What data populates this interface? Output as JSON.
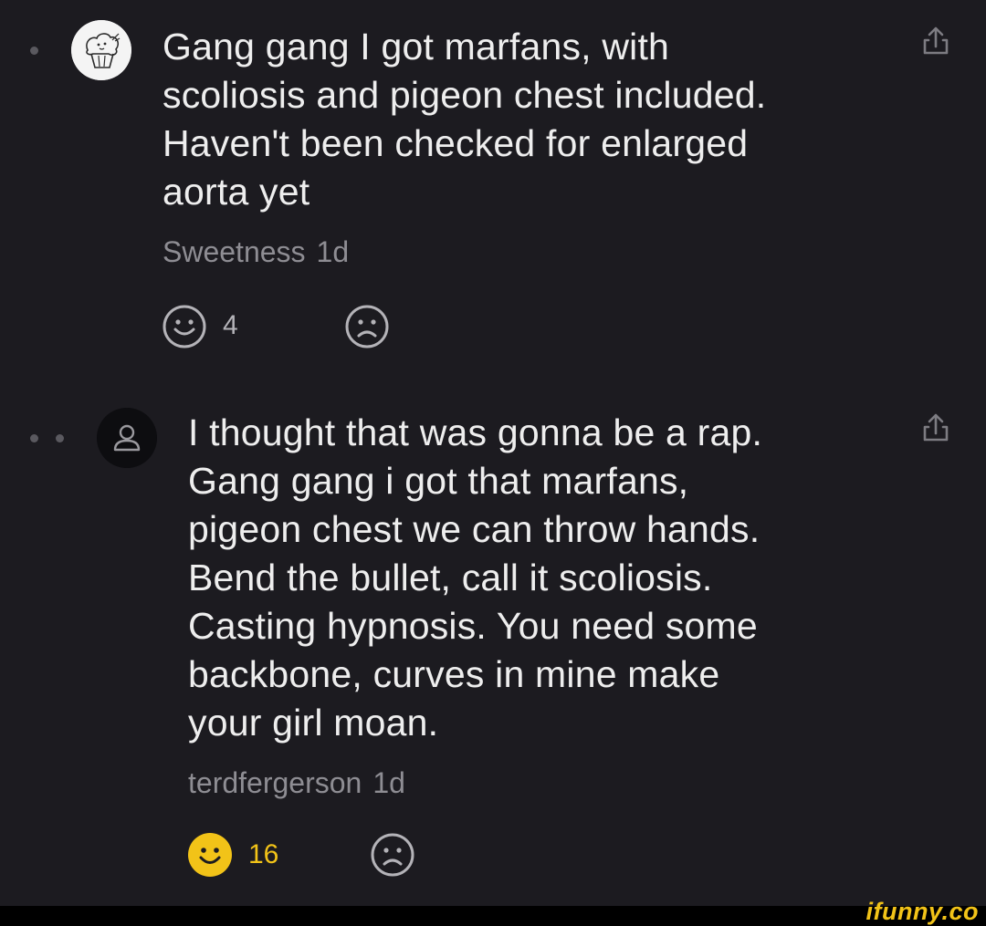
{
  "comments": [
    {
      "text": "Gang gang I got marfans, with\nscoliosis and pigeon chest included.\nHaven't been checked for enlarged\naorta yet",
      "author": "Sweetness",
      "time": "1d",
      "like_count": "4",
      "liked": false,
      "avatar_icon": "muffin-drawing-icon",
      "depth": 1
    },
    {
      "text": "I thought that was gonna be a rap.\nGang gang i got that marfans,\npigeon chest we can throw hands.\nBend the bullet, call it scoliosis.\nCasting hypnosis. You need some\nbackbone, curves in mine make\nyour girl moan.",
      "author": "terdfergerson",
      "time": "1d",
      "like_count": "16",
      "liked": true,
      "avatar_icon": "default-user-icon",
      "depth": 2
    }
  ],
  "icons": {
    "share": "share-icon",
    "like": "smile-icon",
    "dislike": "frown-icon"
  },
  "watermark": "ifunny.co",
  "colors": {
    "background": "#1c1b20",
    "text": "#eeeeee",
    "meta": "#8e8d93",
    "accent": "#f2c318"
  }
}
